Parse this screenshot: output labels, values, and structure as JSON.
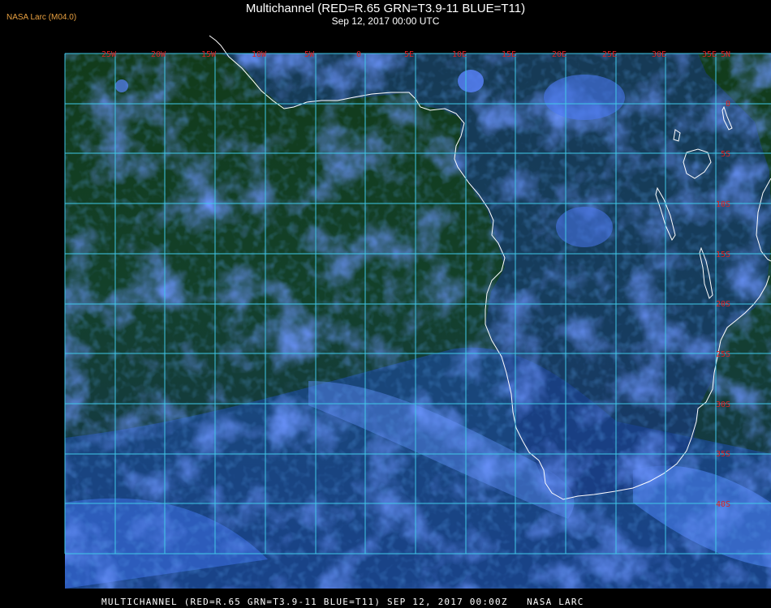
{
  "brand": {
    "label": "NASA Larc (M04.0)",
    "color": "#e8a040"
  },
  "header": {
    "title": "Multichannel (RED=R.65 GRN=T3.9-11 BLUE=T11)",
    "subtitle": "Sep 12, 2017 00:00 UTC"
  },
  "footer": {
    "text": "MULTICHANNEL (RED=R.65 GRN=T3.9-11 BLUE=T11) SEP 12, 2017 00:00Z   NASA LARC"
  },
  "map": {
    "grid_color": "#40c8e8",
    "label_color": "#e02020",
    "coastline_color": "#ffffff",
    "lon_labels": [
      "25W",
      "20W",
      "15W",
      "10W",
      "5W",
      "0",
      "5E",
      "10E",
      "15E",
      "20E",
      "25E",
      "30E",
      "35E"
    ],
    "lat_labels": [
      "5N",
      "0",
      "5S",
      "10S",
      "15S",
      "20S",
      "25S",
      "30S",
      "35S",
      "40S"
    ]
  }
}
